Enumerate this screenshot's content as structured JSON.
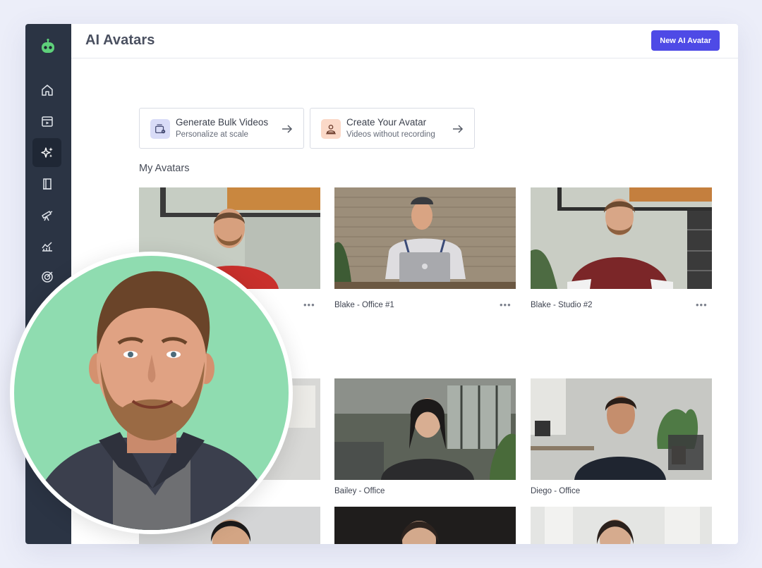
{
  "header": {
    "title": "AI Avatars",
    "new_button": "New AI Avatar"
  },
  "sidebar": {
    "items": [
      {
        "icon": "home-icon"
      },
      {
        "icon": "video-library-icon"
      },
      {
        "icon": "sparkles-icon",
        "active": true
      },
      {
        "icon": "book-icon"
      },
      {
        "icon": "telescope-icon"
      },
      {
        "icon": "analytics-icon"
      },
      {
        "icon": "target-icon"
      }
    ]
  },
  "quick_actions": [
    {
      "title": "Generate Bulk Videos",
      "subtitle": "Personalize at scale",
      "icon": "bulk-video-icon"
    },
    {
      "title": "Create Your Avatar",
      "subtitle": "Videos without recording",
      "icon": "create-avatar-icon"
    }
  ],
  "my_avatars": {
    "title": "My Avatars",
    "items": [
      {
        "name": "",
        "more": "•••"
      },
      {
        "name": "Blake - Office #1",
        "more": "•••"
      },
      {
        "name": "Blake - Studio #2",
        "more": "•••"
      }
    ]
  },
  "stock_avatars": {
    "items": [
      {
        "name": ""
      },
      {
        "name": "Bailey - Office"
      },
      {
        "name": "Diego - Office"
      }
    ]
  },
  "colors": {
    "accent": "#4e4ae6",
    "sidebar": "#2b3444",
    "overlay_bg": "#8fdcb0"
  }
}
